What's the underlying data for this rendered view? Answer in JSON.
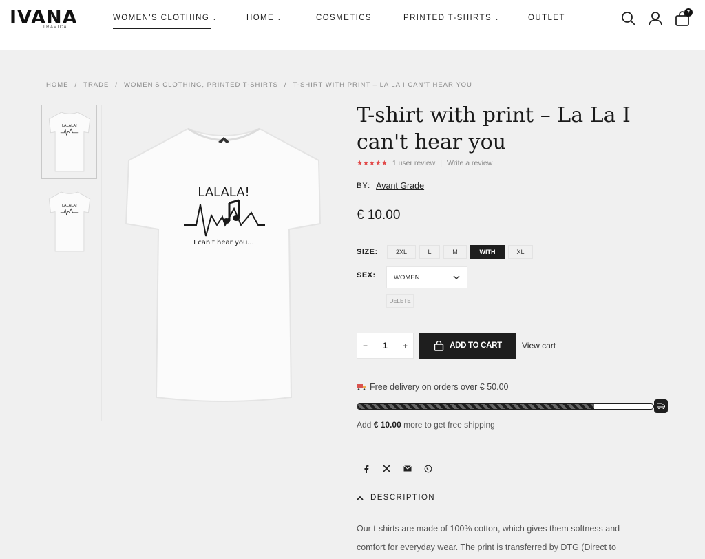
{
  "header": {
    "logo": "IVANA",
    "logo_sub": "TRAVICA",
    "nav": [
      {
        "label": "WOMEN'S CLOTHING",
        "has_dropdown": true,
        "active": true
      },
      {
        "label": "HOME",
        "has_dropdown": true
      },
      {
        "label": "COSMETICS",
        "has_dropdown": false
      },
      {
        "label": "PRINTED T-SHIRTS",
        "has_dropdown": true
      },
      {
        "label": "OUTLET",
        "has_dropdown": false
      }
    ],
    "cart_count": "7",
    "icons": [
      "search-icon",
      "user-icon",
      "shopping-bag-icon"
    ]
  },
  "breadcrumb": {
    "items": [
      "HOME",
      "TRADE",
      "WOMEN'S CLOTHING, PRINTED T-SHIRTS",
      "T-SHIRT WITH PRINT – LA LA I CAN'T HEAR YOU"
    ],
    "separator": "/"
  },
  "gallery": {
    "print_title": "LALALA!",
    "print_subtitle": "I can't hear you...",
    "thumb_count": 2
  },
  "product": {
    "title": "T-shirt with print – La La I can't hear you",
    "stars": "★★★★★",
    "rating_value": 5,
    "review_count": "1 user review",
    "write_review": "Write a review",
    "by_label": "BY:",
    "brand": "Avant Grade",
    "price": "€ 10.00"
  },
  "options": {
    "size_label": "SIZE:",
    "sizes": [
      "2XL",
      "L",
      "M",
      "WITH",
      "XL"
    ],
    "selected_size": "WITH",
    "sex_label": "SEX:",
    "sex_value": "WOMEN",
    "delete_label": "DELETE"
  },
  "cart": {
    "qty_minus": "−",
    "qty_value": "1",
    "qty_plus": "+",
    "add_to_cart": "ADD TO CART",
    "view_cart": "View cart"
  },
  "shipping": {
    "free_delivery": "Free delivery on orders over € 50.00",
    "progress": 0.8,
    "more_prefix": "Add",
    "more_amount": "€ 10.00",
    "more_suffix": "more to get free shipping"
  },
  "share": [
    "facebook-icon",
    "x-icon",
    "mail-icon",
    "whatsapp-icon"
  ],
  "description": {
    "heading": "DESCRIPTION",
    "text": "Our t-shirts are made of 100% cotton, which gives them softness and comfort for everyday wear. The print is transferred by DTG (Direct to"
  },
  "colors": {
    "accent": "#1e1e1e",
    "background": "#f0f0f0",
    "stars": "#e24a4a"
  }
}
